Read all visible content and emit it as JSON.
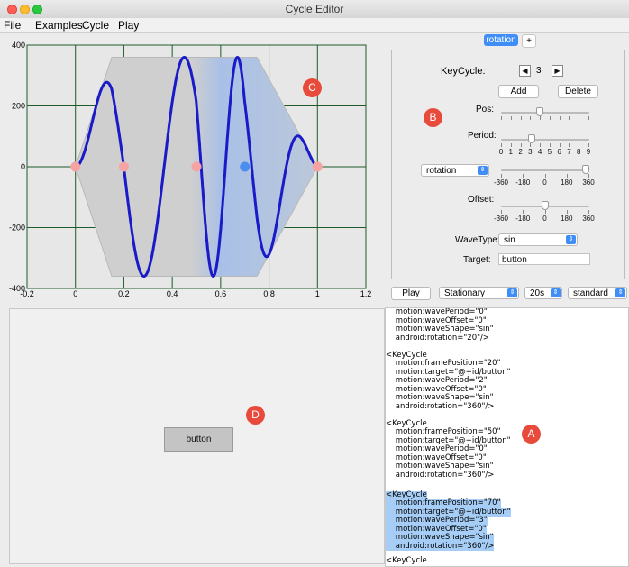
{
  "window": {
    "title": "Cycle Editor"
  },
  "menubar": [
    "File",
    "Examples",
    "Cycle",
    "Play"
  ],
  "plot": {
    "x_ticks": [
      "-0.2",
      "0",
      "0.2",
      "0.4",
      "0.6",
      "0.8",
      "1",
      "1.2"
    ],
    "y_ticks": [
      "400",
      "200",
      "0",
      "-200",
      "-400"
    ],
    "x_range": [
      -0.2,
      1.2
    ],
    "y_range": [
      -400,
      400
    ],
    "keyframes": [
      0,
      0.2,
      0.5,
      0.7,
      1
    ],
    "selected_keyframe": 0.7,
    "curve_color": "#1a1ac8",
    "marker_color": "#f5a3a3",
    "selected_marker_color": "#4a8ef0"
  },
  "tabs": [
    {
      "label": "rotation"
    },
    {
      "label": "+"
    }
  ],
  "panel": {
    "keycycle_label": "KeyCycle:",
    "keycycle_value": "3",
    "prev_glyph": "◀",
    "next_glyph": "▶",
    "add": "Add",
    "delete": "Delete",
    "pos_label": "Pos:",
    "period_label": "Period:",
    "period_ticks": [
      "0",
      "1",
      "2",
      "3",
      "4",
      "5",
      "6",
      "7",
      "8",
      "9"
    ],
    "attribute": "rotation",
    "attribute_ticks": [
      "-360",
      "-180",
      "0",
      "180",
      "360"
    ],
    "offset_label": "Offset:",
    "offset_ticks": [
      "-360",
      "-180",
      "0",
      "180",
      "360"
    ],
    "wavetype_label": "WaveType:",
    "wavetype": "sin",
    "target_label": "Target:",
    "target": "button",
    "pos_level": 0.43,
    "period_level": 0.333,
    "attribute_level": 1.0,
    "offset_level": 0.5
  },
  "controls": {
    "play": "Play",
    "mode": "Stationary",
    "duration": "20s",
    "easing": "standard"
  },
  "preview": {
    "button": "button"
  },
  "code_lines": [
    {
      "t": "    motion:wavePeriod=\"0\"",
      "h": false
    },
    {
      "t": "    motion:waveOffset=\"0\"",
      "h": false
    },
    {
      "t": "    motion:waveShape=\"sin\"",
      "h": false
    },
    {
      "t": "    android:rotation=\"20\"/>",
      "h": false
    },
    {
      "t": " ",
      "h": false
    },
    {
      "t": "<KeyCycle",
      "h": false
    },
    {
      "t": "    motion:framePosition=\"20\"",
      "h": false
    },
    {
      "t": "    motion:target=\"@+id/button\"",
      "h": false
    },
    {
      "t": "    motion:wavePeriod=\"2\"",
      "h": false
    },
    {
      "t": "    motion:waveOffset=\"0\"",
      "h": false
    },
    {
      "t": "    motion:waveShape=\"sin\"",
      "h": false
    },
    {
      "t": "    android:rotation=\"360\"/>",
      "h": false
    },
    {
      "t": " ",
      "h": false
    },
    {
      "t": "<KeyCycle",
      "h": false
    },
    {
      "t": "    motion:framePosition=\"50\"",
      "h": false
    },
    {
      "t": "    motion:target=\"@+id/button\"",
      "h": false
    },
    {
      "t": "    motion:wavePeriod=\"0\"",
      "h": false
    },
    {
      "t": "    motion:waveOffset=\"0\"",
      "h": false
    },
    {
      "t": "    motion:waveShape=\"sin\"",
      "h": false
    },
    {
      "t": "    android:rotation=\"360\"/>",
      "h": false
    },
    {
      "t": " ",
      "h": false
    },
    {
      "t": "<KeyCycle",
      "h": true
    },
    {
      "t": "    motion:framePosition=\"70\"",
      "h": true
    },
    {
      "t": "    motion:target=\"@+id/button\"",
      "h": true
    },
    {
      "t": "    motion:wavePeriod=\"3\"",
      "h": true
    },
    {
      "t": "    motion:waveOffset=\"0\"",
      "h": true
    },
    {
      "t": "    motion:waveShape=\"sin\"",
      "h": true
    },
    {
      "t": "    android:rotation=\"360\"/>",
      "h": true
    },
    {
      "t": " ",
      "h": false
    },
    {
      "t": "<KeyCycle",
      "h": false
    }
  ],
  "badges": {
    "a": "A",
    "b": "B",
    "c": "C",
    "d": "D",
    "color": "#e84a3c"
  }
}
